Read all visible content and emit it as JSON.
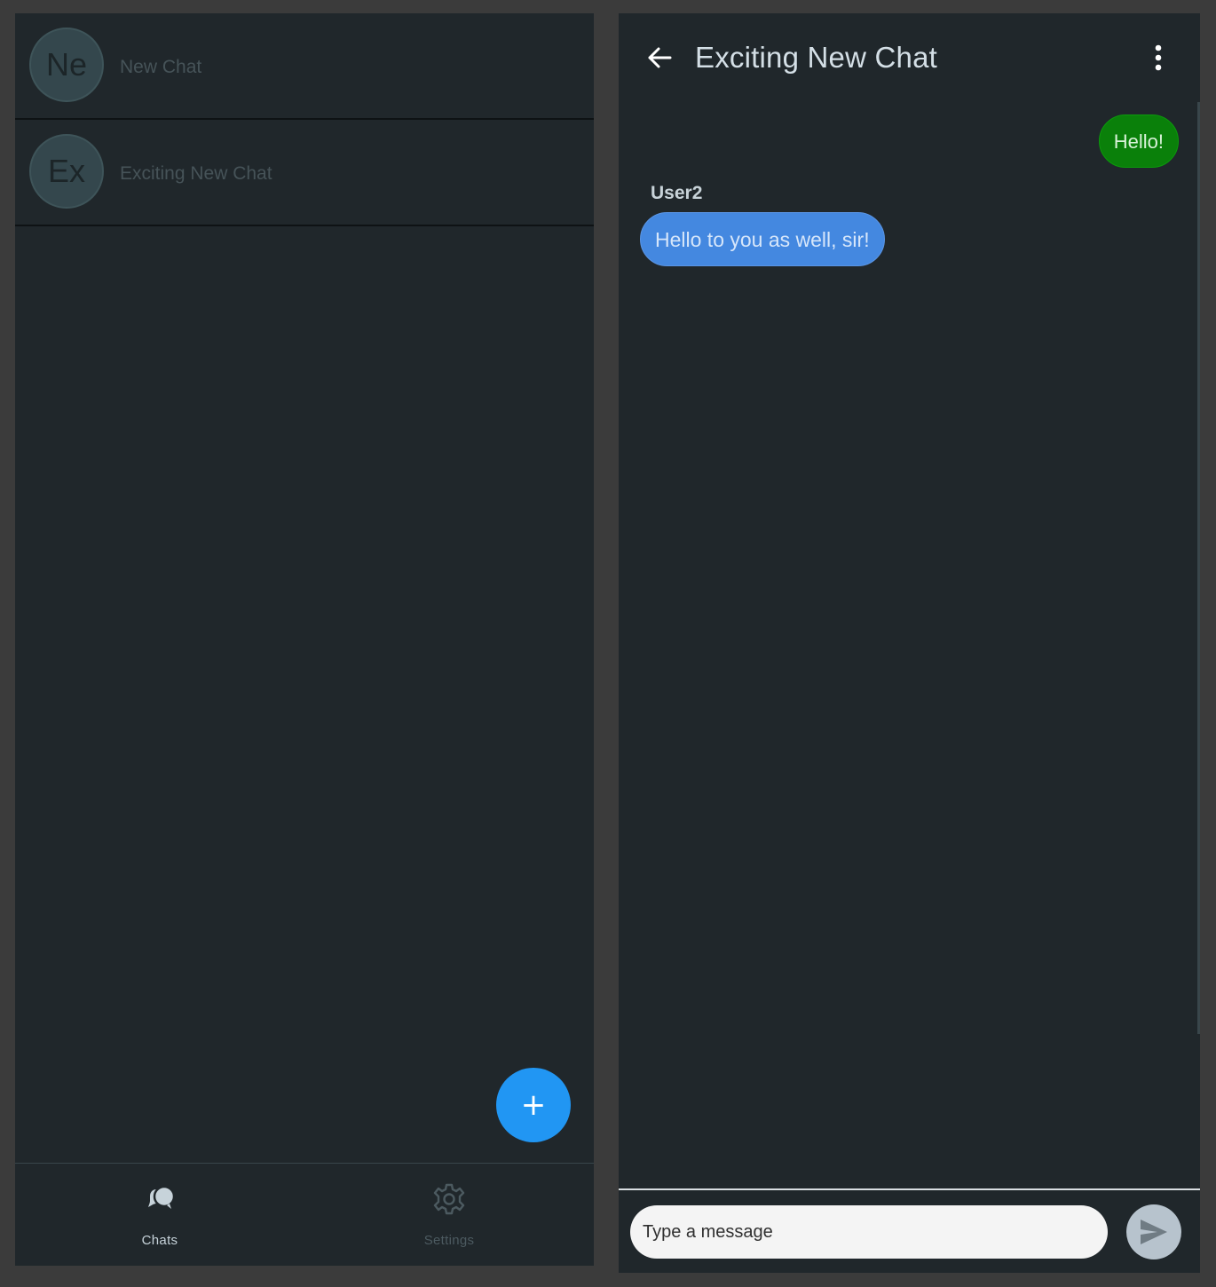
{
  "chat_list": {
    "items": [
      {
        "initials": "Ne",
        "name": "New Chat"
      },
      {
        "initials": "Ex",
        "name": "Exciting New Chat"
      }
    ],
    "fab_label": "+"
  },
  "bottom_nav": {
    "items": [
      {
        "label": "Chats",
        "icon": "chat-bubbles-icon",
        "active": true
      },
      {
        "label": "Settings",
        "icon": "gear-icon",
        "active": false
      }
    ]
  },
  "conversation": {
    "title": "Exciting New Chat",
    "messages": [
      {
        "direction": "outgoing",
        "text": "Hello!"
      },
      {
        "direction": "incoming",
        "sender": "User2",
        "text": "Hello to you as well, sir!"
      }
    ],
    "composer": {
      "placeholder": "Type a message",
      "value": ""
    }
  },
  "colors": {
    "background": "#20272b",
    "fab": "#2196f3",
    "outgoing_bubble": "#0a800a",
    "incoming_bubble": "#4488e0",
    "send_button": "#b7c3cd"
  }
}
